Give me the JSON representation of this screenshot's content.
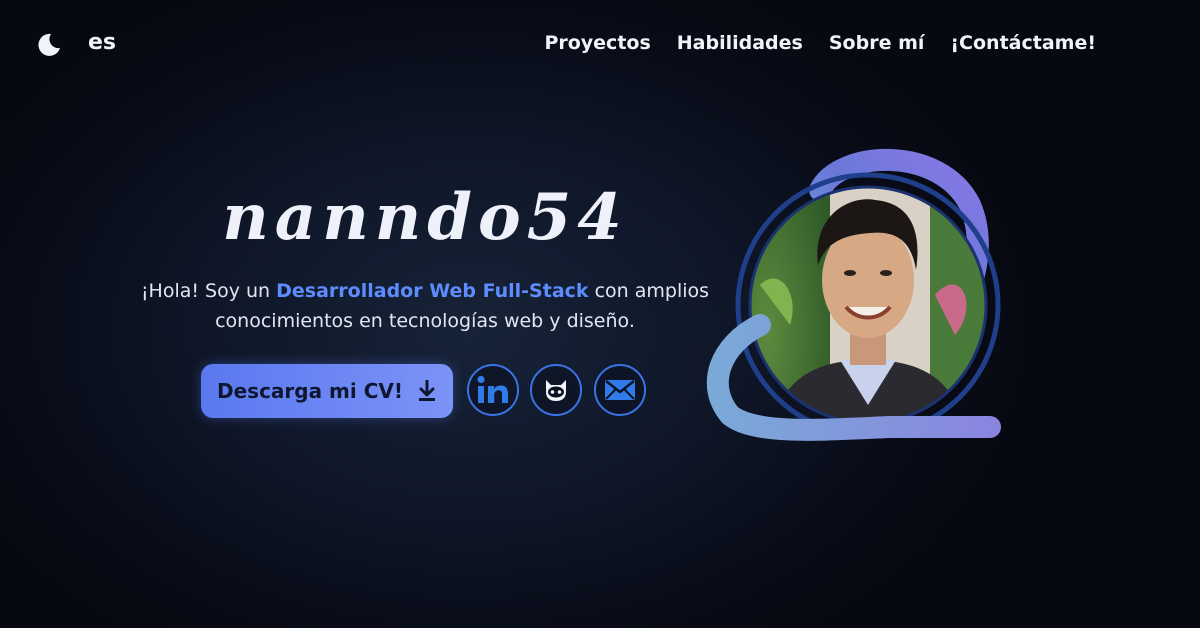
{
  "header": {
    "theme_icon": "moon-icon",
    "language": "es",
    "nav": [
      "Proyectos",
      "Habilidades",
      "Sobre mí",
      "¡Contáctame!"
    ]
  },
  "hero": {
    "title": "nanndo54",
    "intro_before": "¡Hola! Soy un ",
    "intro_highlight": "Desarrollador Web Full-Stack",
    "intro_after": " con amplios conocimientos en tecnologías web y diseño.",
    "cv_button": "Descarga mi CV!",
    "cv_icon": "download-icon",
    "social": [
      "linkedin-icon",
      "github-icon",
      "email-icon"
    ]
  },
  "colors": {
    "accent": "#5d8cff",
    "button_gradient_start": "#5a79f0",
    "button_gradient_end": "#7c93f7",
    "social_border": "#3b73e6"
  }
}
